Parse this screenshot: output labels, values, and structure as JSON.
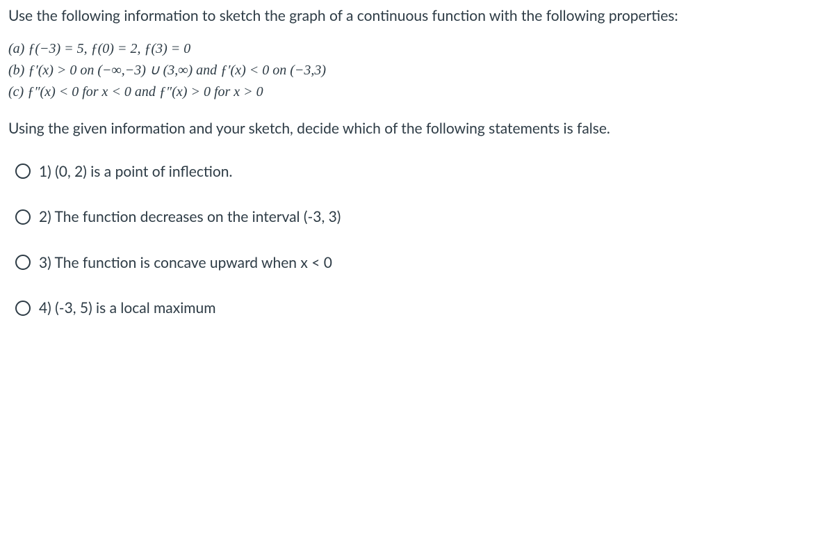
{
  "intro": "Use the following information to sketch the graph of a continuous function with the following properties:",
  "conditions": {
    "a": "(a) ƒ(−3) = 5, ƒ(0) = 2, ƒ(3) = 0",
    "b": "(b) ƒ′(x) > 0 on (−∞,−3) ∪ (3,∞) and ƒ′(x) < 0 on (−3,3)",
    "c": "(c) ƒ″(x) < 0 for x < 0 and ƒ″(x) > 0 for x > 0"
  },
  "question": "Using the given information and your sketch, decide which of the following statements is false.",
  "options": [
    "1) (0, 2) is a point of inflection.",
    "2) The function decreases on the interval (-3, 3)",
    "3) The function is concave upward when x < 0",
    "4) (-3, 5) is a local maximum"
  ]
}
